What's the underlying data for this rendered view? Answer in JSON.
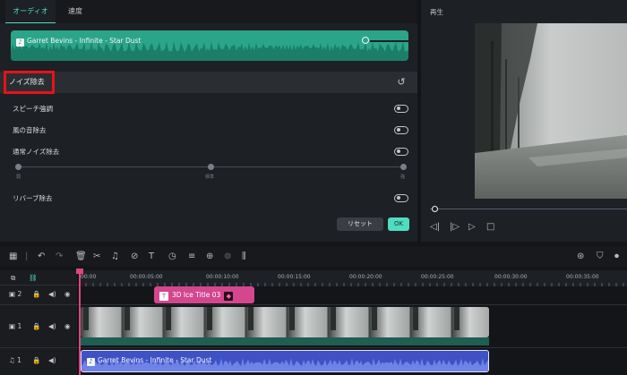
{
  "tabs": [
    {
      "label": "オーディオ",
      "active": true
    },
    {
      "label": "速度",
      "active": false
    }
  ],
  "waveform": {
    "track_title": "Garret Bevins - Infinite - Star Dust",
    "music_icon": "music-note-icon",
    "color": "#2aa58a"
  },
  "noise_section": {
    "title": "ノイズ除去",
    "reset_icon": "reset-icon",
    "highlight_color": "#e8121a"
  },
  "options": [
    {
      "label": "スピーチ強調",
      "enabled": false
    },
    {
      "label": "風の音除去",
      "enabled": false
    },
    {
      "label": "通常ノイズ除去",
      "enabled": false
    },
    {
      "label": "リバーブ除去",
      "enabled": false
    }
  ],
  "noise_slider": {
    "low": "弱",
    "mid": "標準",
    "high": "強"
  },
  "buttons": {
    "reset": "リセット",
    "ok": "OK"
  },
  "preview": {
    "title": "再生",
    "controls": [
      "step-back-icon",
      "play-frame-icon",
      "play-icon",
      "stop-icon"
    ]
  },
  "toolbar": {
    "icons": [
      "grid-icon",
      "undo-icon",
      "redo-icon",
      "trash-icon",
      "cut-icon",
      "audio-icon",
      "tag-icon",
      "text-icon",
      "timer-icon",
      "adjust-icon",
      "add-clip-icon",
      "speed-icon",
      "audio-wave-icon"
    ],
    "right_icons": [
      "render-icon",
      "shield-icon",
      "mic-icon"
    ]
  },
  "ruler": {
    "labels": [
      "00:00",
      "00:00:05:00",
      "00:00:10:00",
      "00:00:15:00",
      "00:00:20:00",
      "00:00:25:00",
      "00:00:30:00",
      "00:00:35:00"
    ]
  },
  "tracks": [
    {
      "number": "2",
      "type": "title"
    },
    {
      "number": "1",
      "type": "video"
    },
    {
      "number": "1",
      "type": "audio"
    }
  ],
  "clips": {
    "title_clip": "3D Ice Title 03",
    "audio_clip": "Garret Bevins - Infinite - Star Dust"
  },
  "colors": {
    "accent": "#4fdcc3",
    "playhead": "#e0447b",
    "title_clip": "#d4468d",
    "audio_clip": "#3f52c4"
  }
}
